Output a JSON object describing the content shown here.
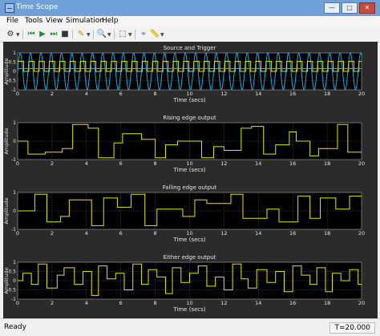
{
  "window": {
    "title": "Time Scope"
  },
  "menu": [
    "File",
    "Tools",
    "View",
    "Simulation",
    "Help"
  ],
  "toolbar": [
    {
      "icon": "gear-icon",
      "glyph": "⚙"
    },
    {
      "icon": "rewind-icon",
      "glyph": "⏮"
    },
    {
      "icon": "run-icon",
      "glyph": "▶"
    },
    {
      "icon": "step-forward-icon",
      "glyph": "⏭"
    },
    {
      "icon": "stop-icon",
      "glyph": "■"
    },
    {
      "icon": "highlight-icon",
      "glyph": "✎"
    },
    {
      "icon": "zoom-icon",
      "glyph": "🔍"
    },
    {
      "icon": "scale-axes-icon",
      "glyph": "⬚"
    },
    {
      "icon": "cursor-icon",
      "glyph": "⌖"
    },
    {
      "icon": "measure-icon",
      "glyph": "📏"
    }
  ],
  "colors": {
    "background": "#2b2b2b",
    "axes": "#000000",
    "grid": "#5a5a5a",
    "text": "#e6e6e6",
    "signal_yellow": "#e6e600",
    "signal_blue": "#1fa7e0",
    "signal_orange": "#e07a2b"
  },
  "status": {
    "text": "Ready",
    "time": "T=20.000"
  },
  "chart_data": [
    {
      "type": "line",
      "title": "Source and Trigger",
      "xlabel": "Time (secs)",
      "ylabel": "Amplitude",
      "xlim": [
        0,
        20
      ],
      "ylim": [
        -1,
        1
      ],
      "x_ticks": [
        0,
        2,
        4,
        6,
        8,
        10,
        12,
        14,
        16,
        18,
        20
      ],
      "y_ticks": [
        -1,
        -0.5,
        0,
        0.5,
        1
      ],
      "y_tick_labels": [
        "-1",
        "-0.5",
        "0",
        "0.5",
        "1"
      ],
      "series": [
        {
          "color": "#1fa7e0",
          "kind": "sine",
          "period": 0.6,
          "amplitude": 1,
          "phase": 0
        },
        {
          "color": "#e6e600",
          "kind": "square",
          "period": 0.6,
          "high": 0.55,
          "low": 0.0,
          "phase": 0.35
        },
        {
          "color": "#e07a2b",
          "kind": "constant",
          "value": 0.15
        }
      ]
    },
    {
      "type": "line",
      "title": "Rising edge output",
      "xlabel": "Time (secs)",
      "ylabel": "Amplitude",
      "xlim": [
        0,
        20
      ],
      "ylim": [
        -1,
        1
      ],
      "x_ticks": [
        0,
        2,
        4,
        6,
        8,
        10,
        12,
        14,
        16,
        18,
        20
      ],
      "y_ticks": [
        -1,
        0,
        1
      ],
      "y_tick_labels": [
        "-1",
        "0",
        "1"
      ],
      "series": [
        {
          "color": "#e6e600",
          "kind": "step",
          "x": [
            0,
            0.6,
            1.6,
            2.6,
            3.2,
            4.1,
            4.7,
            5.6,
            6.1,
            7.2,
            8.0,
            8.6,
            9.3,
            10.7,
            11.4,
            12.0,
            13.0,
            13.6,
            14.3,
            15.0,
            15.8,
            16.2,
            17.0,
            17.5,
            18.6,
            19.2,
            20.0
          ],
          "y": [
            0.0,
            -0.7,
            -0.6,
            -0.4,
            0.9,
            0.7,
            -0.9,
            -0.1,
            0.4,
            0.1,
            -0.9,
            -0.2,
            0.0,
            -0.9,
            -0.3,
            -0.5,
            0.7,
            0.8,
            -0.7,
            -0.2,
            0.5,
            0.0,
            -0.8,
            -0.4,
            0.9,
            -0.6,
            -0.6
          ]
        }
      ]
    },
    {
      "type": "line",
      "title": "Falling edge output",
      "xlabel": "Time (secs)",
      "ylabel": "Amplitude",
      "xlim": [
        0,
        20
      ],
      "ylim": [
        -1,
        1
      ],
      "x_ticks": [
        0,
        2,
        4,
        6,
        8,
        10,
        12,
        14,
        16,
        18,
        20
      ],
      "y_ticks": [
        -1,
        0,
        1
      ],
      "y_tick_labels": [
        "-1",
        "0",
        "1"
      ],
      "series": [
        {
          "color": "#e6e600",
          "kind": "step",
          "x": [
            0,
            1.0,
            1.7,
            2.5,
            3.0,
            4.3,
            5.0,
            5.8,
            6.6,
            7.4,
            8.1,
            9.6,
            10.3,
            11.0,
            12.4,
            13.1,
            14.5,
            15.2,
            16.3,
            17.0,
            17.6,
            18.5,
            19.3,
            20.0
          ],
          "y": [
            0.0,
            0.9,
            -0.6,
            -0.3,
            0.6,
            -0.8,
            0.7,
            0.2,
            0.9,
            -0.8,
            0.1,
            -0.3,
            0.6,
            0.4,
            0.9,
            -0.4,
            0.1,
            -0.6,
            0.8,
            -0.4,
            0.7,
            0.1,
            0.8,
            0.8
          ]
        }
      ]
    },
    {
      "type": "line",
      "title": "Either edge output",
      "xlabel": "Time (secs)",
      "ylabel": "Amplitude",
      "xlim": [
        0,
        20
      ],
      "ylim": [
        -1,
        1
      ],
      "x_ticks": [
        0,
        2,
        4,
        6,
        8,
        10,
        12,
        14,
        16,
        18,
        20
      ],
      "y_ticks": [
        -1,
        -0.5,
        0,
        0.5,
        1
      ],
      "y_tick_labels": [
        "-1",
        "-0.5",
        "0",
        "0.5",
        "1"
      ],
      "series": [
        {
          "color": "#e6e600",
          "kind": "step",
          "x": [
            0,
            0.3,
            0.8,
            1.2,
            1.7,
            2.3,
            2.7,
            3.3,
            3.8,
            4.3,
            4.7,
            5.2,
            5.7,
            6.2,
            6.7,
            7.2,
            7.6,
            8.1,
            8.6,
            9.0,
            9.5,
            10.0,
            10.5,
            11.0,
            11.5,
            12.0,
            12.5,
            13.0,
            13.4,
            13.9,
            14.5,
            15.0,
            15.5,
            16.0,
            16.5,
            17.0,
            17.4,
            17.9,
            18.3,
            18.8,
            19.3,
            19.8,
            20.0
          ],
          "y": [
            0.0,
            0.4,
            -0.2,
            0.9,
            -0.4,
            0.3,
            0.7,
            -0.2,
            0.5,
            -0.8,
            0.8,
            0.1,
            0.4,
            -0.5,
            0.9,
            -0.2,
            0.6,
            0.2,
            -0.7,
            0.7,
            -0.1,
            0.4,
            0.8,
            -0.3,
            0.2,
            -0.5,
            0.9,
            0.1,
            -0.4,
            0.6,
            -0.1,
            0.5,
            -0.6,
            0.8,
            0.3,
            -0.2,
            0.7,
            -0.6,
            0.4,
            0.0,
            0.6,
            -0.2,
            -0.2
          ]
        }
      ]
    }
  ]
}
